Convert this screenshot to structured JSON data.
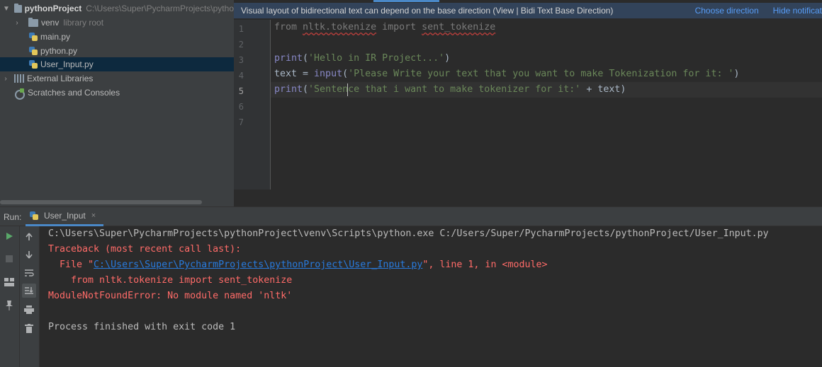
{
  "project_tree": {
    "root": {
      "name": "pythonProject",
      "path": "C:\\Users\\Super\\PycharmProjects\\pytho"
    },
    "venv": {
      "name": "venv",
      "note": "library root"
    },
    "files": [
      "main.py",
      "python.py",
      "User_Input.py"
    ],
    "external_libraries": "External Libraries",
    "scratches": "Scratches and Consoles"
  },
  "notification": {
    "message": "Visual layout of bidirectional text can depend on the base direction (View | Bidi Text Base Direction)",
    "choose_direction": "Choose direction",
    "hide": "Hide notificat"
  },
  "editor": {
    "line_numbers": [
      "1",
      "2",
      "3",
      "4",
      "5",
      "6",
      "7"
    ],
    "current_line": "5",
    "lines": {
      "l1_from": "from ",
      "l1_module": "nltk.tokenize",
      "l1_import": " import ",
      "l1_name": "sent_tokenize",
      "l3_print": "print",
      "l3_open": "(",
      "l3_str": "'Hello in IR Project...'",
      "l3_close": ")",
      "l4_lhs": "text = ",
      "l4_fn": "input",
      "l4_open": "(",
      "l4_str": "'Please Write your text that you want to make Tokenization for it: '",
      "l4_close": ")",
      "l5_print": "print",
      "l5_open": "(",
      "l5_str": "'Sentence that i want to make tokenizer for it:'",
      "l5_rest": " + text)"
    }
  },
  "run": {
    "label": "Run:",
    "tab": "User_Input",
    "tab_close": "×",
    "console": {
      "cmd": "C:\\Users\\Super\\PycharmProjects\\pythonProject\\venv\\Scripts\\python.exe C:/Users/Super/PycharmProjects/pythonProject/User_Input.py",
      "traceback": "Traceback (most recent call last):",
      "file_prefix": "  File \"",
      "file_link": "C:\\Users\\Super\\PycharmProjects\\pythonProject\\User_Input.py",
      "file_suffix": "\", line 1, in <module>",
      "code_line": "    from nltk.tokenize import sent_tokenize",
      "error": "ModuleNotFoundError: No module named 'nltk'",
      "finished": "Process finished with exit code 1"
    }
  },
  "colors": {
    "accent": "#4a88c7",
    "error": "#ff6b68",
    "string": "#6a8759",
    "link": "#287bde"
  }
}
